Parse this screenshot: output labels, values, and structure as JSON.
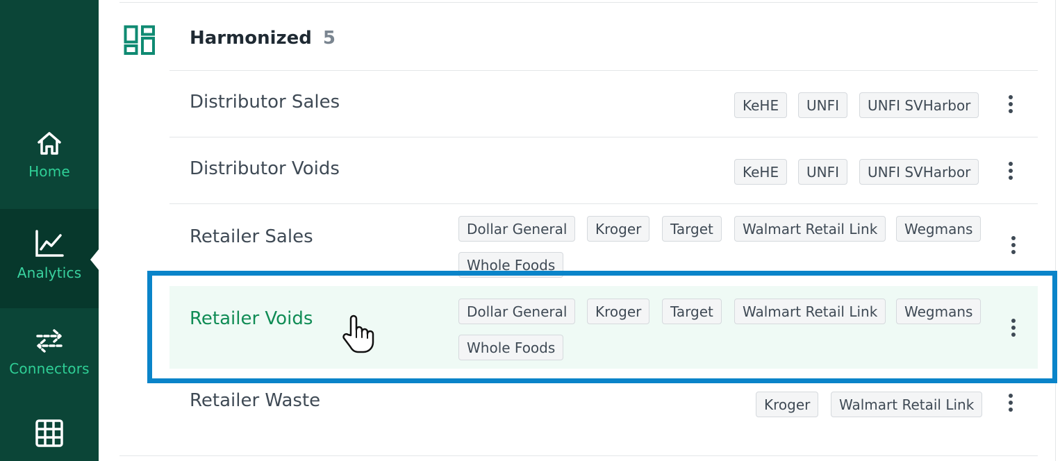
{
  "sidebar": {
    "items": [
      {
        "label": "Home",
        "icon": "home-icon"
      },
      {
        "label": "Analytics",
        "icon": "chart-line-icon",
        "active": true
      },
      {
        "label": "Connectors",
        "icon": "arrows-exchange-icon"
      },
      {
        "label": "",
        "icon": "grid-icon"
      }
    ]
  },
  "group": {
    "title": "Harmonized",
    "count": "5"
  },
  "rows": [
    {
      "title": "Distributor Sales",
      "tags": [
        "KeHE",
        "UNFI",
        "UNFI SVHarbor"
      ]
    },
    {
      "title": "Distributor Voids",
      "tags": [
        "KeHE",
        "UNFI",
        "UNFI SVHarbor"
      ]
    },
    {
      "title": "Retailer Sales",
      "tags": [
        "Dollar General",
        "Kroger",
        "Target",
        "Walmart Retail Link",
        "Wegmans",
        "Whole Foods"
      ]
    },
    {
      "title": "Retailer Voids",
      "tags": [
        "Dollar General",
        "Kroger",
        "Target",
        "Walmart Retail Link",
        "Wegmans",
        "Whole Foods"
      ],
      "hovered": true
    },
    {
      "title": "Retailer Waste",
      "tags": [
        "Kroger",
        "Walmart Retail Link"
      ]
    }
  ],
  "colors": {
    "sidebar_bg": "#0b4537",
    "accent_green": "#2fcf96",
    "hover_title": "#108c55",
    "focus_outline": "#0a84c9"
  }
}
